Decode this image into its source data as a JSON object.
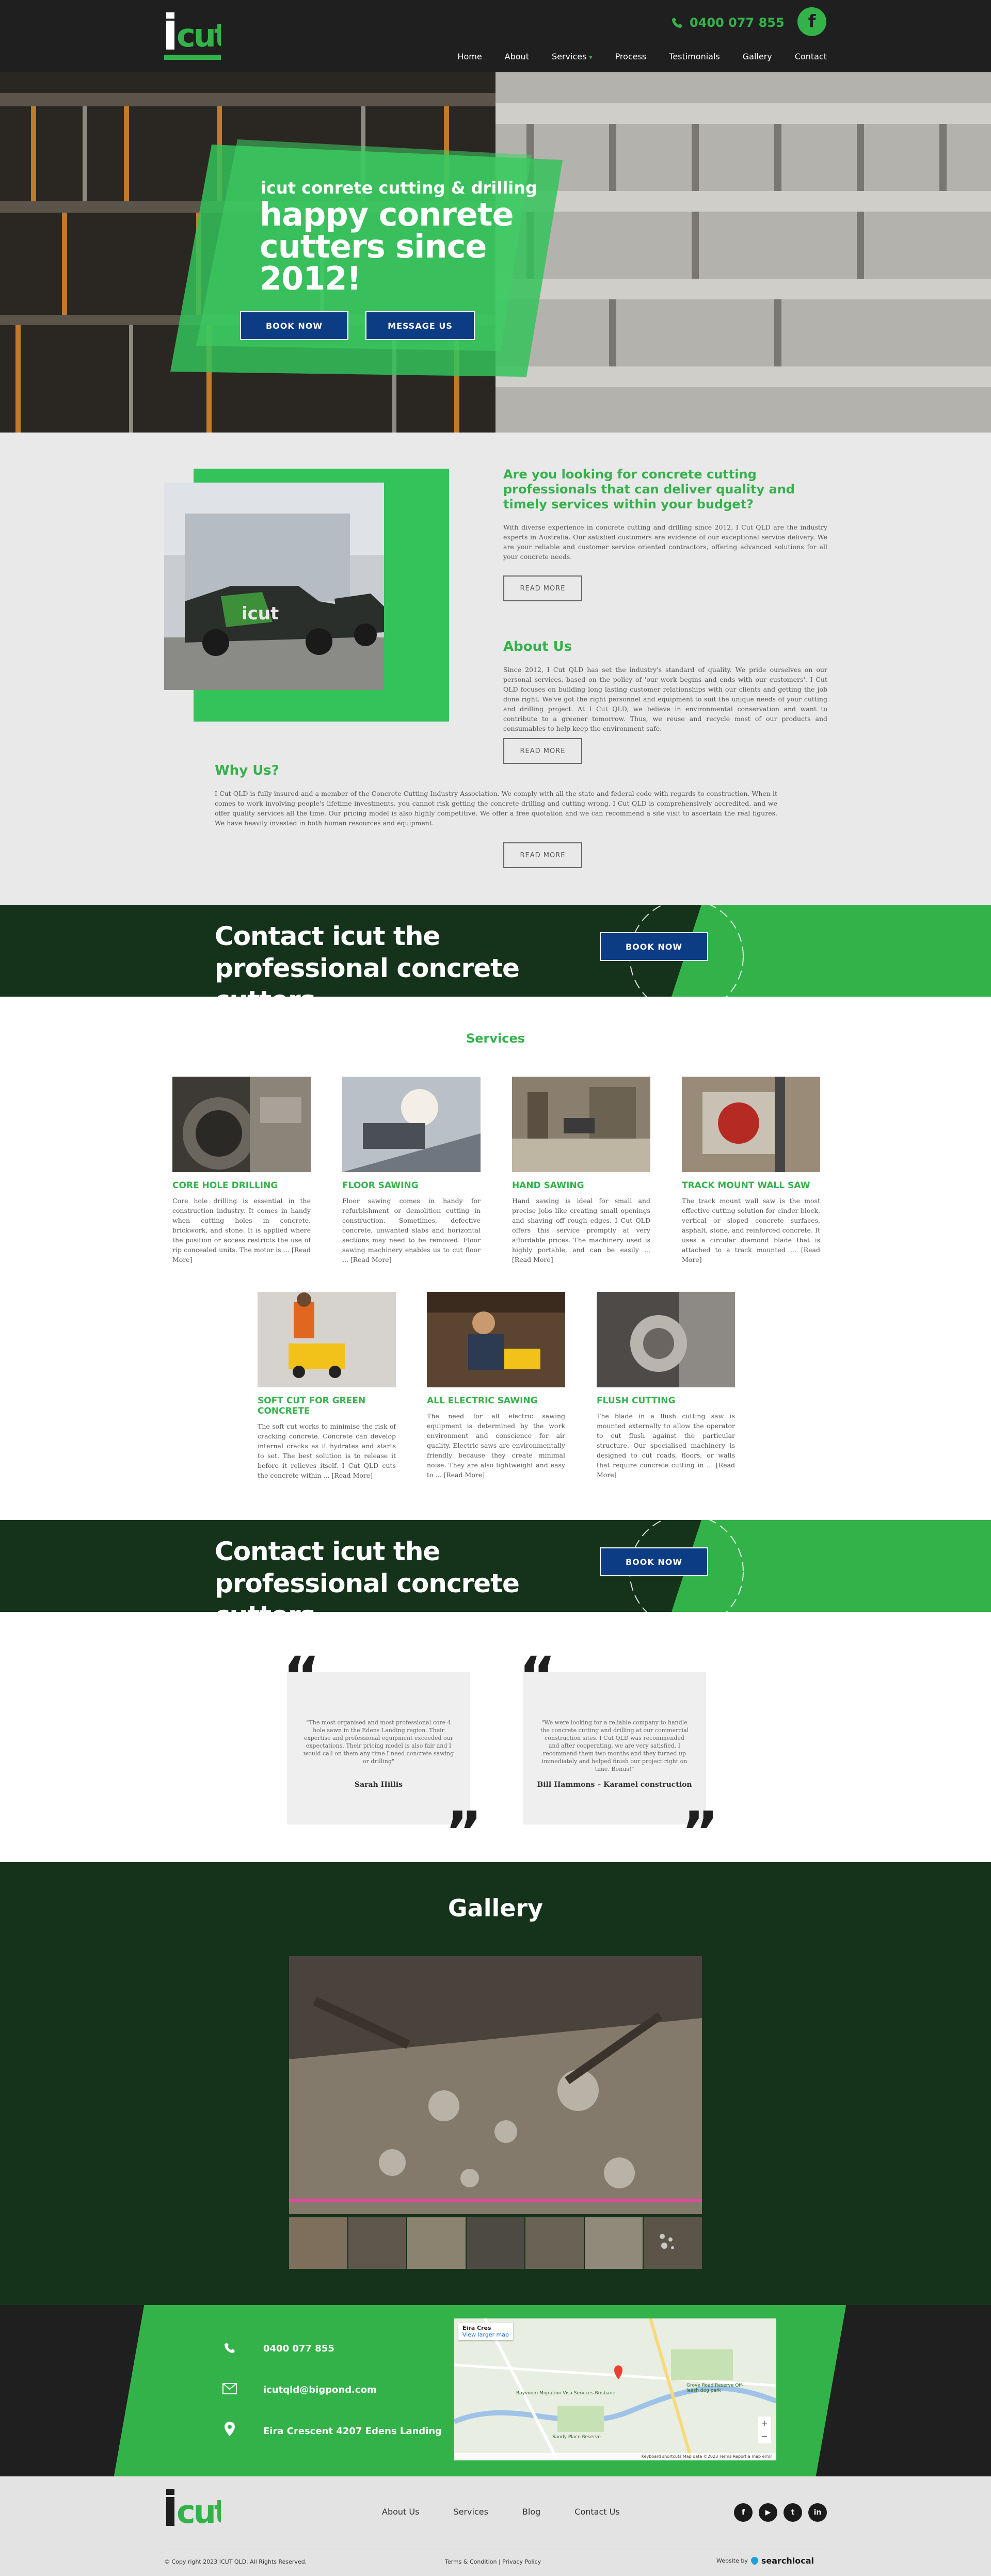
{
  "header": {
    "logo_text": "icut",
    "phone": "0400 077 855",
    "facebook_icon": "facebook-icon",
    "nav": [
      "Home",
      "About",
      "Services",
      "Process",
      "Testimonials",
      "Gallery",
      "Contact"
    ],
    "services_caret": "▾"
  },
  "hero": {
    "subtitle": "icut conrete cutting & drilling",
    "title": "happy conrete cutters since 2012!",
    "book_label": "BOOK NOW",
    "message_label": "MESSAGE US"
  },
  "intro": {
    "question": "Are you looking for concrete cutting professionals that can deliver quality and timely services within your budget?",
    "question_text": "With diverse experience in concrete cutting and drilling since 2012, I Cut QLD are the industry experts in Australia. Our satisfied customers are evidence of our exceptional service delivery. We are your reliable and customer service oriented contractors, offering advanced solutions for all your concrete needs.",
    "read_more_1": "READ MORE",
    "about_title": "About Us",
    "about_text": "Since 2012, I Cut QLD has set the industry's standard of quality. We pride ourselves on our personal services, based on the policy of 'our work begins and ends with our customers'. I Cut QLD focuses on building long lasting customer relationships with our clients and getting the job done right. We've got the right personnel and equipment to suit the unique needs of your cutting and drilling project. At I Cut QLD, we believe in environmental conservation and want to contribute to a greener tomorrow. Thus, we reuse and recycle most of our products and consumables to help keep the environment safe.",
    "read_more_2": "READ MORE",
    "why_title": "Why Us?",
    "why_text": "I Cut QLD is fully insured and a member of the Concrete Cutting Industry Association. We comply with all the state and federal code with regards to construction. When it comes to work involving people's lifetime investments, you cannot risk getting the concrete drilling and cutting wrong. I Cut QLD is comprehensively accredited, and we offer quality services all the time. Our pricing model is also highly competitive. We offer a free quotation and we can recommend a site visit to ascertain the real figures. We have heavily invested in both human resources and equipment.",
    "read_more_3": "READ MORE"
  },
  "cta": {
    "title": "Contact icut the professional concrete cutters",
    "book_label": "BOOK NOW"
  },
  "services": {
    "title": "Services",
    "items": [
      {
        "title": "CORE HOLE DRILLING",
        "text": "Core hole drilling is essential in the construction industry. It comes in handy when cutting holes in concrete, brickwork, and stone. It is applied where the position or access restricts the use of rip concealed units. The motor is ... [Read More]"
      },
      {
        "title": "FLOOR SAWING",
        "text": "Floor sawing comes in handy for refurbishment or demolition cutting in construction. Sometimes, defective concrete, unwanted slabs and horizontal sections may need to be removed. Floor sawing machinery enables us to cut floor ... [Read More]"
      },
      {
        "title": "HAND SAWING",
        "text": "Hand sawing is ideal for small and precise jobs like creating small openings and shaving off rough edges. I Cut QLD offers this service promptly at very affordable prices. The machinery used is highly portable, and can be easily ... [Read More]"
      },
      {
        "title": "TRACK MOUNT WALL SAW",
        "text": "The track mount wall saw is the most effective cutting solution for cinder block, vertical or sloped concrete surfaces, asphalt, stone, and reinforced concrete. It uses a circular diamond blade that is attached to a track mounted ... [Read More]"
      },
      {
        "title": "SOFT CUT FOR GREEN CONCRETE",
        "text": "The soft cut works to minimise the risk of cracking concrete. Concrete can develop internal cracks as it hydrates and starts to set. The best solution is to release it before it relieves itself. I Cut QLD cuts the concrete within ... [Read More]"
      },
      {
        "title": "ALL ELECTRIC SAWING",
        "text": "The need for all electric sawing equipment is determined by the work environment and conscience for air quality. Electric saws are environmentally friendly because they create minimal noise. They are also lightweight and easy to ... [Read More]"
      },
      {
        "title": "FLUSH CUTTING",
        "text": "The blade in a flush cutting saw is mounted externally to allow the operator to cut flush against the particular structure. Our specialised machinery is designed to cut roads, floors, or walls that require concrete cutting in ... [Read More]"
      }
    ]
  },
  "testimonials": [
    {
      "quote": "\"The most organised and most professional core 4 hole sawn in the Edens Landing region. Their expertise and professional equipment exceeded our expectations. Their pricing model is also fair and I would call on them any time I need concrete sawing or drilling\"",
      "name": "Sarah Hillis"
    },
    {
      "quote": "\"We were looking for a reliable company to handle the concrete cutting and drilling at our commercial construction sites. I Cut QLD was recommended and after cooperating, we are very satisfied. I recommend them two months and they turned up immediately and helped finish our project right on time. Bonus!\"",
      "name": "Bill Hammons – Karamel construction"
    }
  ],
  "gallery": {
    "title": "Gallery"
  },
  "contact": {
    "phone": "0400 077 855",
    "email": "icutqld@bigpond.com",
    "address": "Eira Crescent 4207 Edens Landing",
    "map_place": "Eira Cres",
    "map_link": "View larger map",
    "map_labels": [
      "Bayvoom Migration Visa Services Brisbane",
      "Grove Road Reserve Off-leash dog park",
      "Sandy Place Reserve"
    ],
    "map_footer": "Keyboard shortcuts   Map data ©2023   Terms   Report a map error"
  },
  "footer": {
    "logo_text": "icut",
    "nav": [
      "About Us",
      "Services",
      "Blog",
      "Contact Us"
    ],
    "social": [
      "f",
      "▶",
      "t",
      "in"
    ],
    "copyright": "© Copy right 2023 ICUT QLD. All Rights Reserved.",
    "terms": "Terms & Condition | Privacy Policy",
    "website_by": "Website by",
    "searchlocal": "searchlocal"
  },
  "colors": {
    "green": "#34b24a",
    "dark": "#1f1f1f",
    "forest": "#15321b",
    "navy": "#0c3d84"
  }
}
